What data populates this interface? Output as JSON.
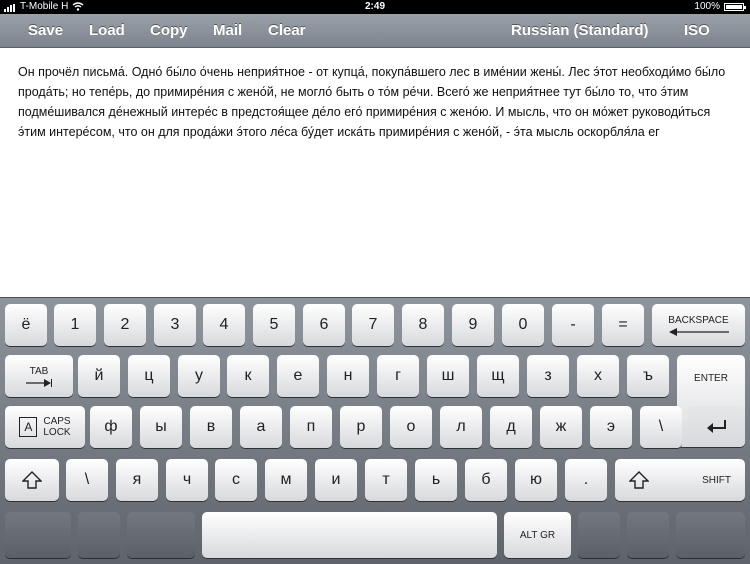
{
  "status": {
    "carrier": "T-Mobile H",
    "time": "2:49",
    "battery": "100%"
  },
  "toolbar": {
    "save": "Save",
    "load": "Load",
    "copy": "Copy",
    "mail": "Mail",
    "clear": "Clear",
    "layout": "Russian (Standard)",
    "iso": "ISO"
  },
  "document": {
    "text": "Он прочёл письма́. Одно́ бы́ло о́чень неприя́тное - от купца́, покупа́вшего лес в име́нии жены́. Лес э́тот необходи́мо бы́ло прода́ть; но тепе́рь, до примире́ния с жено́й, не могло́ быть о то́м ре́чи. Всего́ же неприя́тнее тут бы́ло то, что э́тим подме́шивался де́нежный интере́с в предстоя́щее де́ло его́ примире́ния с жено́ю. И мысль, что он мо́жет руководи́ться э́тим интере́сом, что он для прода́жи э́того ле́са бу́дет иска́ть примире́ния с жено́й, - э́та мысль оскорбля́ла ег"
  },
  "keyboard": {
    "row1": [
      "ё",
      "1",
      "2",
      "3",
      "4",
      "5",
      "6",
      "7",
      "8",
      "9",
      "0",
      "-",
      "="
    ],
    "backspace": "BACKSPACE",
    "tab": "TAB",
    "row2": [
      "й",
      "ц",
      "у",
      "к",
      "е",
      "н",
      "г",
      "ш",
      "щ",
      "з",
      "х",
      "ъ"
    ],
    "enter": "ENTER",
    "caps_line1": "CAPS",
    "caps_line2": "LOCK",
    "caps_box": "A",
    "row3": [
      "ф",
      "ы",
      "в",
      "а",
      "п",
      "р",
      "о",
      "л",
      "д",
      "ж",
      "э",
      "\\"
    ],
    "row4": [
      "\\",
      "я",
      "ч",
      "с",
      "м",
      "и",
      "т",
      "ь",
      "б",
      "ю",
      "."
    ],
    "shift": "SHIFT",
    "altgr": "ALT GR"
  }
}
